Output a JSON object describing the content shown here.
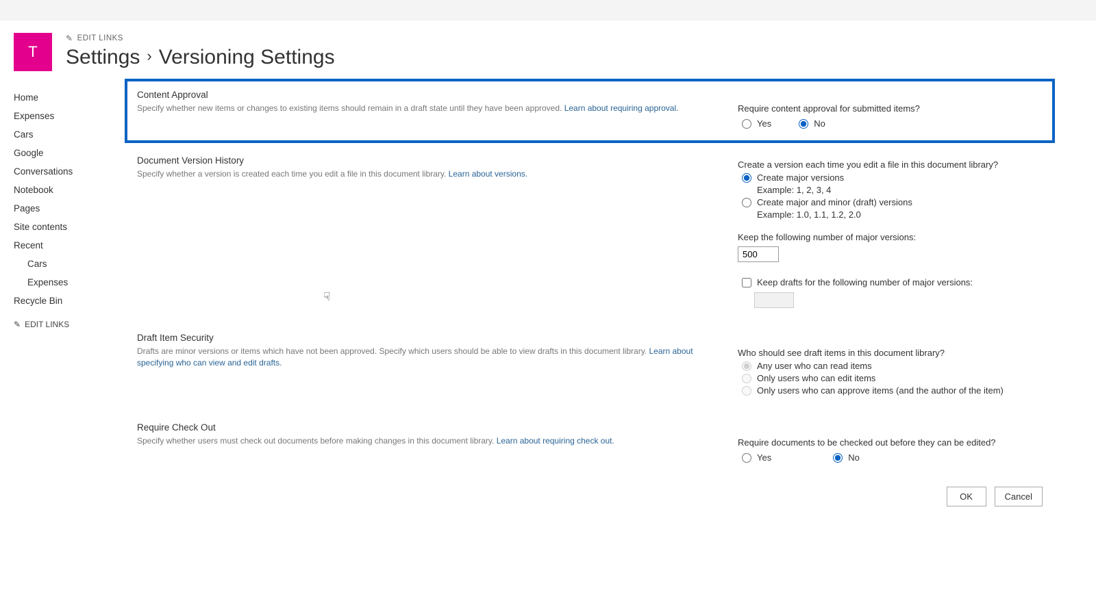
{
  "suiteBar": {},
  "siteLogoLetter": "T",
  "editLinksTop": "EDIT LINKS",
  "breadcrumb": {
    "parent": "Settings",
    "caret": "›",
    "current": "Versioning Settings"
  },
  "leftNav": {
    "items": [
      "Home",
      "Expenses",
      "Cars",
      "Google",
      "Conversations",
      "Notebook",
      "Pages",
      "Site contents",
      "Recent"
    ],
    "recentItems": [
      "Cars",
      "Expenses"
    ],
    "recycle": "Recycle Bin",
    "editLinks": "EDIT LINKS"
  },
  "sections": {
    "contentApproval": {
      "title": "Content Approval",
      "desc": "Specify whether new items or changes to existing items should remain in a draft state until they have been approved.  ",
      "learn": "Learn about requiring approval.",
      "question": "Require content approval for submitted items?",
      "yes": "Yes",
      "no": "No"
    },
    "versionHistory": {
      "title": "Document Version History",
      "desc": "Specify whether a version is created each time you edit a file in this document library.  ",
      "learn": "Learn about versions.",
      "question": "Create a version each time you edit a file in this document library?",
      "majorLabel": "Create major versions",
      "majorExample": "Example: 1, 2, 3, 4",
      "minorLabel": "Create major and minor (draft) versions",
      "minorExample": "Example: 1.0, 1.1, 1.2, 2.0",
      "keepMajorLabel": "Keep the following number of major versions:",
      "keepMajorValue": "500",
      "keepDraftsLabel": "Keep drafts for the following number of major versions:"
    },
    "draftSecurity": {
      "title": "Draft Item Security",
      "desc": "Drafts are minor versions or items which have not been approved. Specify which users should be able to view drafts in this document library.  ",
      "learn": "Learn about specifying who can view and edit drafts.",
      "question": "Who should see draft items in this document library?",
      "opt1": "Any user who can read items",
      "opt2": "Only users who can edit items",
      "opt3": "Only users who can approve items (and the author of the item)"
    },
    "checkout": {
      "title": "Require Check Out",
      "desc": "Specify whether users must check out documents before making changes in this document library.  ",
      "learn": "Learn about requiring check out.",
      "question": "Require documents to be checked out before they can be edited?",
      "yes": "Yes",
      "no": "No"
    }
  },
  "buttons": {
    "ok": "OK",
    "cancel": "Cancel"
  }
}
